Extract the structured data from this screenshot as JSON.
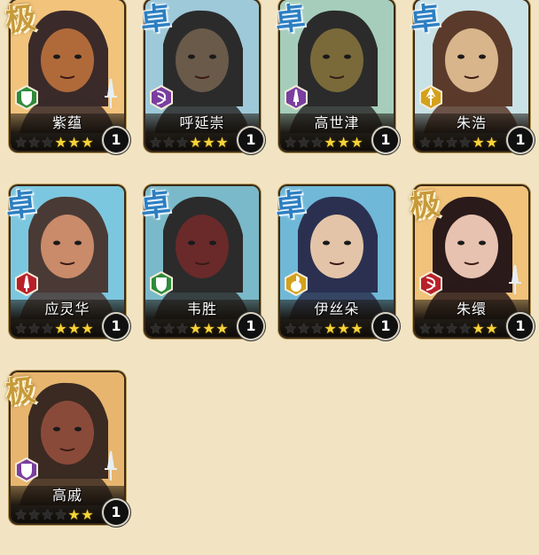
{
  "heroes": [
    {
      "name": "紫蕴",
      "tier": "极",
      "level": "1",
      "stars": {
        "dark": 3,
        "gold": 3
      },
      "type_icon": "shield-icon",
      "type_color": "#2e8b3a",
      "weapon_icon": "sword-icon"
    },
    {
      "name": "呼延崇",
      "tier": "卓",
      "level": "1",
      "stars": {
        "dark": 3,
        "gold": 3
      },
      "type_icon": "bow-icon",
      "type_color": "#7a3ea0",
      "weapon_icon": ""
    },
    {
      "name": "高世津",
      "tier": "卓",
      "level": "1",
      "stars": {
        "dark": 3,
        "gold": 3
      },
      "type_icon": "dagger-icon",
      "type_color": "#7a3ea0",
      "weapon_icon": ""
    },
    {
      "name": "朱浩",
      "tier": "卓",
      "level": "1",
      "stars": {
        "dark": 4,
        "gold": 2
      },
      "type_icon": "spear-icon",
      "type_color": "#d4a11a",
      "weapon_icon": ""
    },
    {
      "name": "应灵华",
      "tier": "卓",
      "level": "1",
      "stars": {
        "dark": 3,
        "gold": 3
      },
      "type_icon": "dagger-icon",
      "type_color": "#b8202a",
      "weapon_icon": ""
    },
    {
      "name": "韦胜",
      "tier": "卓",
      "level": "1",
      "stars": {
        "dark": 3,
        "gold": 3
      },
      "type_icon": "shield-icon",
      "type_color": "#2e8b3a",
      "weapon_icon": ""
    },
    {
      "name": "伊丝朵",
      "tier": "卓",
      "level": "1",
      "stars": {
        "dark": 3,
        "gold": 3
      },
      "type_icon": "gourd-icon",
      "type_color": "#d4a11a",
      "weapon_icon": ""
    },
    {
      "name": "朱缳",
      "tier": "极",
      "level": "1",
      "stars": {
        "dark": 4,
        "gold": 2
      },
      "type_icon": "bow-icon",
      "type_color": "#b8202a",
      "weapon_icon": "sword-icon"
    },
    {
      "name": "高戚",
      "tier": "极",
      "level": "1",
      "stars": {
        "dark": 4,
        "gold": 2
      },
      "type_icon": "shield-icon",
      "type_color": "#7a3ea0",
      "weapon_icon": "sword-icon"
    }
  ]
}
